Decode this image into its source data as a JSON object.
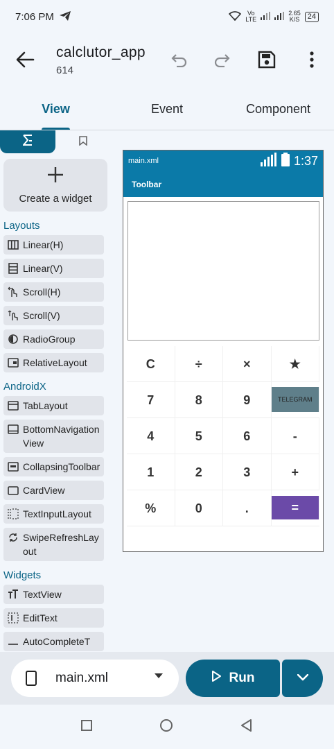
{
  "status_bar": {
    "time": "7:06 PM",
    "net_speed_top": "2.65",
    "net_speed_bottom": "K/S",
    "volte": "Vo LTE",
    "battery": "24"
  },
  "app_bar": {
    "title": "calclutor_app",
    "subtitle": "614"
  },
  "tabs": [
    {
      "label": "View",
      "active": true
    },
    {
      "label": "Event",
      "active": false
    },
    {
      "label": "Component",
      "active": false
    }
  ],
  "palette": {
    "create_label": "Create a widget",
    "sections": {
      "layouts": "Layouts",
      "androidx": "AndroidX",
      "widgets": "Widgets"
    },
    "layouts": [
      {
        "label": "Linear(H)",
        "icon": "columns-icon"
      },
      {
        "label": "Linear(V)",
        "icon": "rows-icon"
      },
      {
        "label": "Scroll(H)",
        "icon": "swipe-horizontal-icon"
      },
      {
        "label": "Scroll(V)",
        "icon": "swipe-vertical-icon"
      },
      {
        "label": "RadioGroup",
        "icon": "radio-icon"
      },
      {
        "label": "RelativeLayout",
        "icon": "relative-layout-icon"
      }
    ],
    "androidx": [
      {
        "label": "TabLayout",
        "icon": "tab-icon"
      },
      {
        "label": "BottomNavigationView",
        "icon": "bottom-nav-icon"
      },
      {
        "label": "CollapsingToolbar",
        "icon": "collapsing-toolbar-icon"
      },
      {
        "label": "CardView",
        "icon": "card-icon"
      },
      {
        "label": "TextInputLayout",
        "icon": "text-input-icon"
      },
      {
        "label": "SwipeRefreshLayout",
        "icon": "refresh-icon"
      }
    ],
    "widgets": [
      {
        "label": "TextView",
        "icon": "text-icon"
      },
      {
        "label": "EditText",
        "icon": "edit-text-icon"
      },
      {
        "label": "AutoCompleteT",
        "icon": "autocomplete-icon"
      }
    ]
  },
  "preview": {
    "file": "main.xml",
    "time": "1:37",
    "toolbar": "Toolbar",
    "keys": [
      [
        "C",
        "÷",
        "×",
        "★"
      ],
      [
        "7",
        "8",
        "9",
        "TELEGRAM"
      ],
      [
        "4",
        "5",
        "6",
        "-"
      ],
      [
        "1",
        "2",
        "3",
        "+"
      ],
      [
        "%",
        "0",
        ".",
        "="
      ]
    ],
    "colors": {
      "toolbar": "#0b7aa8",
      "telegram_key": "#5f7f8a",
      "equal_key": "#6b4aa8"
    }
  },
  "bottom_bar": {
    "file_name": "main.xml",
    "run_label": "Run"
  },
  "colors": {
    "accent": "#0b6486",
    "background": "#f2f6fb"
  }
}
